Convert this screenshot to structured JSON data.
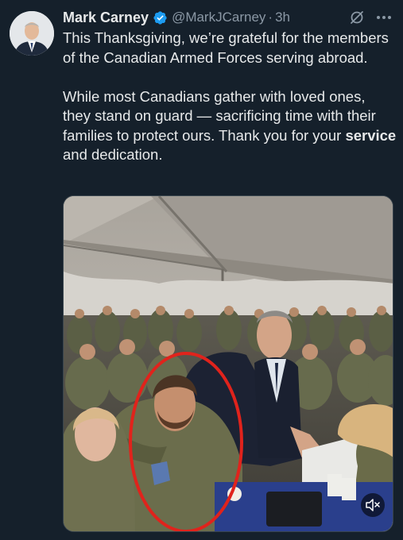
{
  "author": {
    "name": "Mark Carney",
    "handle": "@MarkJCarney",
    "separator": "·",
    "time": "3h",
    "verified_color": "#1d9bf0"
  },
  "tweet": {
    "paragraph1": "This Thanksgiving, we’re grateful for the members of the Canadian Armed Forces serving abroad.",
    "paragraph2_start": "While most Canadians gather with loved ones, they stand on guard — sacrificing time with their families to protect ours. Thank you for your ",
    "paragraph2_bold": "service",
    "paragraph2_end": " and dedication."
  },
  "media": {
    "type": "video",
    "annotation_color": "#e0231c"
  },
  "icons": {
    "verified": "verified-badge-icon",
    "grok": "grok-icon",
    "more": "more-icon",
    "mute": "muted-speaker-icon"
  },
  "colors": {
    "background": "#15202b",
    "text": "#e7e9ea",
    "secondary_text": "#8b98a5"
  }
}
